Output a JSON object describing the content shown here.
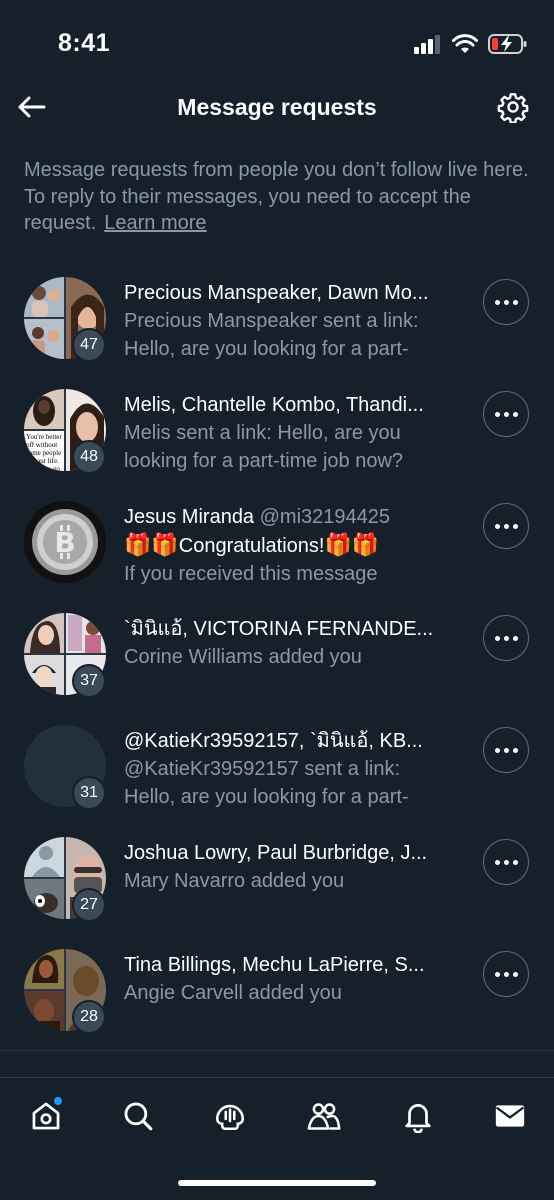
{
  "status_bar": {
    "time": "8:41"
  },
  "header": {
    "title": "Message requests"
  },
  "description": {
    "text": "Message requests from people you don’t follow live here. To reply to their messages, you need to accept the request.",
    "learn_more": "Learn more"
  },
  "requests": [
    {
      "title": "Precious Manspeaker, Dawn Mo...",
      "handle": "",
      "preview_1": "Precious Manspeaker sent a link:",
      "preview_2": "Hello, are you looking for a part-",
      "count": "47"
    },
    {
      "title": "Melis, Chantelle Kombo, Thandi...",
      "handle": "",
      "preview_1": "Melis sent a link: Hello, are you",
      "preview_2": "looking for a part-time job now?",
      "count": "48"
    },
    {
      "title": "Jesus Miranda",
      "handle": "@mi32194425",
      "preview_1": "Congratulations!",
      "preview_2": "If you received this message",
      "count": ""
    },
    {
      "title": "`มินิแอ้, VICTORINA FERNANDE...",
      "handle": "",
      "preview_1": "Corine Williams added you",
      "preview_2": "",
      "count": "37"
    },
    {
      "title": "@KatieKr39592157, `มินิแอ้, KB...",
      "handle": "",
      "preview_1": "@KatieKr39592157 sent a link:",
      "preview_2": "Hello, are you looking for a part-",
      "count": "31"
    },
    {
      "title": "Joshua Lowry, Paul Burbridge, J...",
      "handle": "",
      "preview_1": "Mary Navarro added you",
      "preview_2": "",
      "count": "27"
    },
    {
      "title": "Tina Billings, Mechu LaPierre, S...",
      "handle": "",
      "preview_1": "Angie Carvell added you",
      "preview_2": "",
      "count": "28"
    }
  ],
  "avatar_texts": {
    "melis_meme": "You're better off without some people in your life. Let them go"
  },
  "icons": {
    "back": "back-arrow-icon",
    "settings": "gear-icon",
    "more": "more-horizontal-icon",
    "gift": "gift-emoji-icon",
    "tabs": [
      "home-icon",
      "search-icon",
      "spaces-icon",
      "communities-icon",
      "notifications-icon",
      "messages-icon"
    ]
  },
  "colors": {
    "background": "#15202b",
    "secondary_text": "#8b98a5",
    "accent": "#1d9bf0"
  }
}
